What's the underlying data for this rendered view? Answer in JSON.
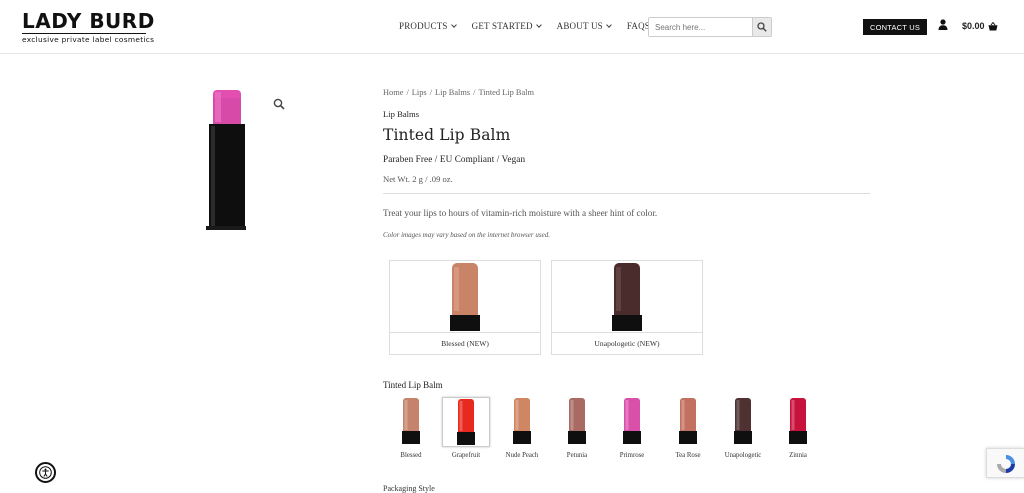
{
  "brand": {
    "name": "LADY BURD",
    "tagline": "exclusive private label cosmetics"
  },
  "nav": [
    {
      "label": "PRODUCTS",
      "dropdown": true
    },
    {
      "label": "GET STARTED",
      "dropdown": true
    },
    {
      "label": "ABOUT US",
      "dropdown": true
    },
    {
      "label": "FAQS",
      "dropdown": false
    }
  ],
  "search": {
    "placeholder": "Search here...",
    "icon": "search-icon"
  },
  "header": {
    "contact_label": "CONTACT US",
    "cart_total": "$0.00"
  },
  "breadcrumb": [
    "Home",
    "Lips",
    "Lip Balms",
    "Tinted Lip Balm"
  ],
  "product": {
    "category": "Lip Balms",
    "title": "Tinted Lip Balm",
    "features": "Paraben Free / EU Compliant / Vegan",
    "net_wt": "Net Wt. 2 g / .09 oz.",
    "description": "Treat your lips to hours of vitamin-rich moisture with a sheer hint of color.",
    "color_note": "Color images may vary based on the internet browser used.",
    "main_color": "#e24fb0"
  },
  "featured": [
    {
      "label": "Blessed (NEW)",
      "color": "#c98468"
    },
    {
      "label": "Unapologetic (NEW)",
      "color": "#4a2c2c"
    }
  ],
  "swatch_section": {
    "label": "Tinted Lip Balm",
    "selected": "Grapefruit"
  },
  "swatches": [
    {
      "label": "Blessed",
      "color": "#c4836a"
    },
    {
      "label": "Grapefruit",
      "color": "#e8291e"
    },
    {
      "label": "Nude Peach",
      "color": "#cf8662"
    },
    {
      "label": "Petunia",
      "color": "#a86a62"
    },
    {
      "label": "Primrose",
      "color": "#d94faa"
    },
    {
      "label": "Tea Rose",
      "color": "#c2705f"
    },
    {
      "label": "Unapologetic",
      "color": "#4f3131"
    },
    {
      "label": "Zinnia",
      "color": "#c7133c"
    }
  ],
  "next_section": "Packaging Style"
}
